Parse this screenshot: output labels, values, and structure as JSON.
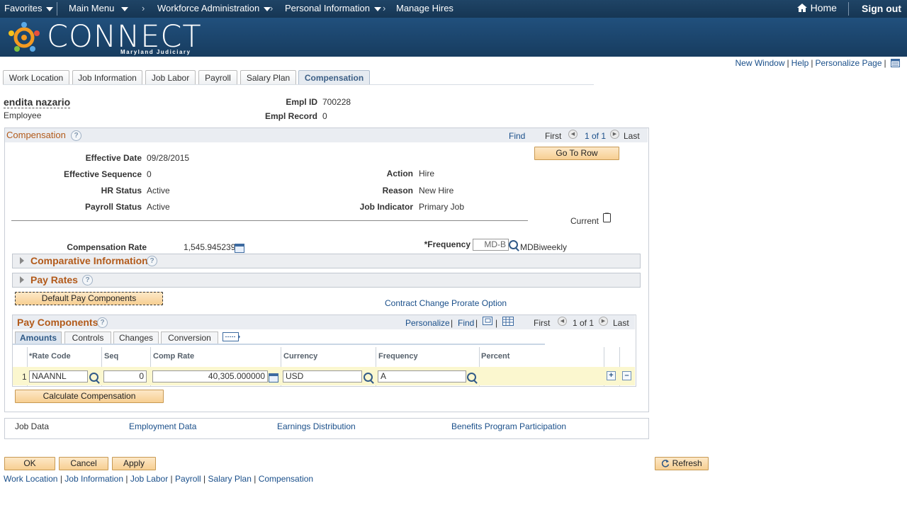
{
  "nav": {
    "favorites": "Favorites",
    "main_menu": "Main Menu",
    "workforce_admin": "Workforce Administration",
    "personal_info": "Personal Information",
    "manage_hires": "Manage Hires",
    "home": "Home",
    "sign_out": "Sign out"
  },
  "brand": {
    "name": "CONNECT",
    "sub": "Maryland Judiciary"
  },
  "top_links": {
    "new_window": "New Window",
    "help": "Help",
    "personalize_page": "Personalize Page"
  },
  "tabs": [
    {
      "label": "Work Location"
    },
    {
      "label": "Job Information"
    },
    {
      "label": "Job Labor"
    },
    {
      "label": "Payroll"
    },
    {
      "label": "Salary Plan"
    },
    {
      "label": "Compensation"
    }
  ],
  "employee": {
    "name": "endita nazario",
    "role": "Employee",
    "empl_id_label": "Empl ID",
    "empl_id": "700228",
    "empl_record_label": "Empl Record",
    "empl_record": "0"
  },
  "compensation": {
    "title": "Compensation",
    "find": "Find",
    "first": "First",
    "count": "1 of 1",
    "last": "Last",
    "go_to_row": "Go To Row",
    "effective_date_label": "Effective Date",
    "effective_date": "09/28/2015",
    "effective_seq_label": "Effective Sequence",
    "effective_seq": "0",
    "hr_status_label": "HR Status",
    "hr_status": "Active",
    "payroll_status_label": "Payroll Status",
    "payroll_status": "Active",
    "action_label": "Action",
    "action": "Hire",
    "reason_label": "Reason",
    "reason": "New Hire",
    "job_indicator_label": "Job Indicator",
    "job_indicator": "Primary Job",
    "current_label": "Current",
    "comp_rate_label": "Compensation Rate",
    "comp_rate": "1,545.945239",
    "frequency_label": "*Frequency",
    "frequency_code": "MD-B",
    "frequency_desc": "MDBiweekly",
    "comparative_info": "Comparative Information",
    "pay_rates": "Pay Rates",
    "default_pay_components": "Default Pay Components",
    "contract_change": "Contract Change Prorate Option"
  },
  "pay_components": {
    "title": "Pay Components",
    "personalize": "Personalize",
    "find": "Find",
    "first": "First",
    "count": "1 of 1",
    "last": "Last",
    "tabs": [
      "Amounts",
      "Controls",
      "Changes",
      "Conversion"
    ],
    "columns": [
      "*Rate Code",
      "Seq",
      "Comp Rate",
      "Currency",
      "Frequency",
      "Percent"
    ],
    "rows": [
      {
        "num": "1",
        "rate_code": "NAANNL",
        "seq": "0",
        "comp_rate": "40,305.000000",
        "currency": "USD",
        "frequency": "A",
        "percent": ""
      }
    ],
    "calculate": "Calculate Compensation"
  },
  "bottom_links": {
    "job_data": "Job Data",
    "employment_data": "Employment Data",
    "earnings_distribution": "Earnings Distribution",
    "benefits": "Benefits Program Participation"
  },
  "buttons": {
    "ok": "OK",
    "cancel": "Cancel",
    "apply": "Apply",
    "refresh": "Refresh"
  },
  "footer_links": [
    "Work Location",
    "Job Information",
    "Job Labor",
    "Payroll",
    "Salary Plan",
    "Compensation"
  ]
}
